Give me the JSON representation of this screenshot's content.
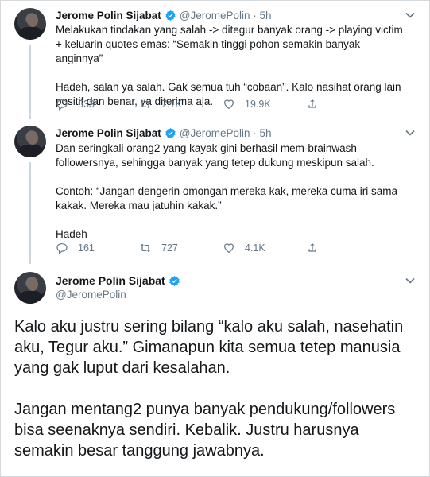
{
  "tweets": [
    {
      "author_name": "Jerome Polin Sijabat",
      "handle_time": "@JeromePolin · 5h",
      "text": "Melakukan tindakan yang salah -> ditegur banyak orang -> playing victim + keluarin quotes emas: “Semakin tinggi pohon semakin banyak anginnya”\n\nHadeh, salah ya salah. Gak semua tuh “cobaan”. Kalo nasihat orang lain positif dan benar, ya diterima aja.",
      "replies": "533",
      "retweets": "7.1K",
      "likes": "19.9K"
    },
    {
      "author_name": "Jerome Polin Sijabat",
      "handle_time": "@JeromePolin · 5h",
      "text": "Dan seringkali orang2 yang kayak gini berhasil mem-brainwash followersnya, sehingga banyak yang tetep dukung meskipun salah.\n\nContoh: “Jangan dengerin omongan mereka kak, mereka cuma iri sama kakak. Mereka mau jatuhin kakak.”\n\nHadeh",
      "replies": "161",
      "retweets": "727",
      "likes": "4.1K"
    }
  ],
  "main_tweet": {
    "author_name": "Jerome Polin Sijabat",
    "handle": "@JeromePolin",
    "text": "Kalo aku justru sering bilang “kalo aku salah, nasehatin aku, Tegur aku.” Gimanapun kita semua tetep manusia yang gak luput dari kesalahan.\n\nJangan mentang2 punya banyak pendukung/followers bisa seenaknya sendiri. Kebalik. Justru harusnya semakin besar tanggung jawabnya."
  },
  "colors": {
    "verified": "#1da1f2",
    "muted": "#657786",
    "text": "#14171a"
  },
  "icons": [
    "verified-badge-icon",
    "chevron-down-icon",
    "reply-icon",
    "retweet-icon",
    "like-icon",
    "share-icon"
  ]
}
